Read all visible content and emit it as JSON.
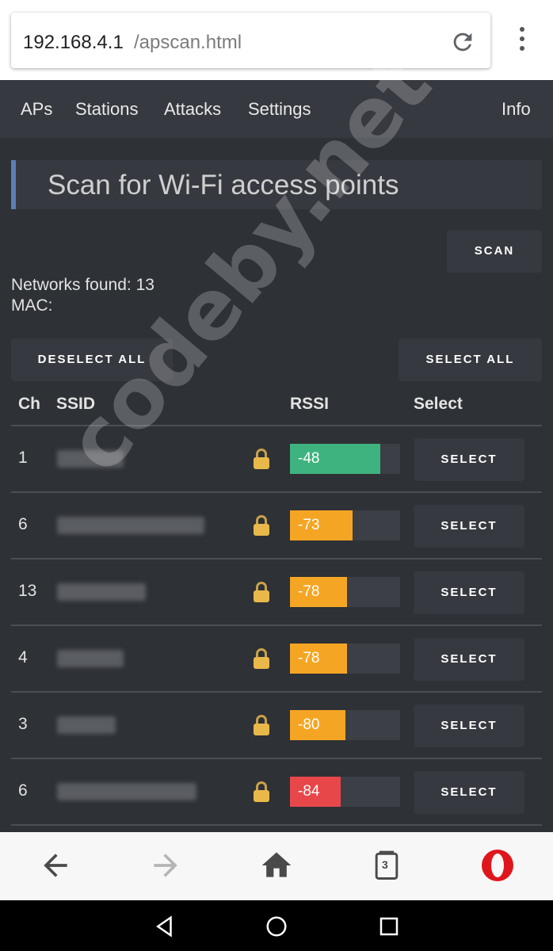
{
  "browser": {
    "url_host": "192.168.4.1",
    "url_path": "/apscan.html"
  },
  "nav": {
    "items": [
      "APs",
      "Stations",
      "Attacks",
      "Settings"
    ],
    "info": "Info"
  },
  "page": {
    "title": "Scan for Wi-Fi access points",
    "scan_label": "SCAN",
    "networks_found": "Networks found: 13",
    "mac": "MAC:",
    "deselect_all": "DESELECT ALL",
    "select_all": "SELECT ALL"
  },
  "table": {
    "headers": [
      "Ch",
      "SSID",
      "RSSI",
      "Select"
    ],
    "rows": [
      {
        "ch": "1",
        "rssi": "-48",
        "rssi_fraction": 0.82,
        "color": "#3fb37f",
        "select_label": "SELECT"
      },
      {
        "ch": "6",
        "rssi": "-73",
        "rssi_fraction": 0.57,
        "color": "#f5a524",
        "select_label": "SELECT"
      },
      {
        "ch": "13",
        "rssi": "-78",
        "rssi_fraction": 0.52,
        "color": "#f5a524",
        "select_label": "SELECT"
      },
      {
        "ch": "4",
        "rssi": "-78",
        "rssi_fraction": 0.52,
        "color": "#f5a524",
        "select_label": "SELECT"
      },
      {
        "ch": "3",
        "rssi": "-80",
        "rssi_fraction": 0.5,
        "color": "#f5a524",
        "select_label": "SELECT"
      },
      {
        "ch": "6",
        "rssi": "-84",
        "rssi_fraction": 0.46,
        "color": "#e8474a",
        "select_label": "SELECT"
      }
    ]
  },
  "watermark": "codeby.net",
  "colors": {
    "accent_bar": "#5b7fb5",
    "good": "#3fb37f",
    "medium": "#f5a524",
    "bad": "#e8474a",
    "opera_red": "#e0161d"
  },
  "bottom_bar": {
    "tab_count": "3",
    "icons": [
      "back-arrow-icon",
      "forward-arrow-icon",
      "home-icon",
      "tabs-icon",
      "opera-logo"
    ]
  }
}
